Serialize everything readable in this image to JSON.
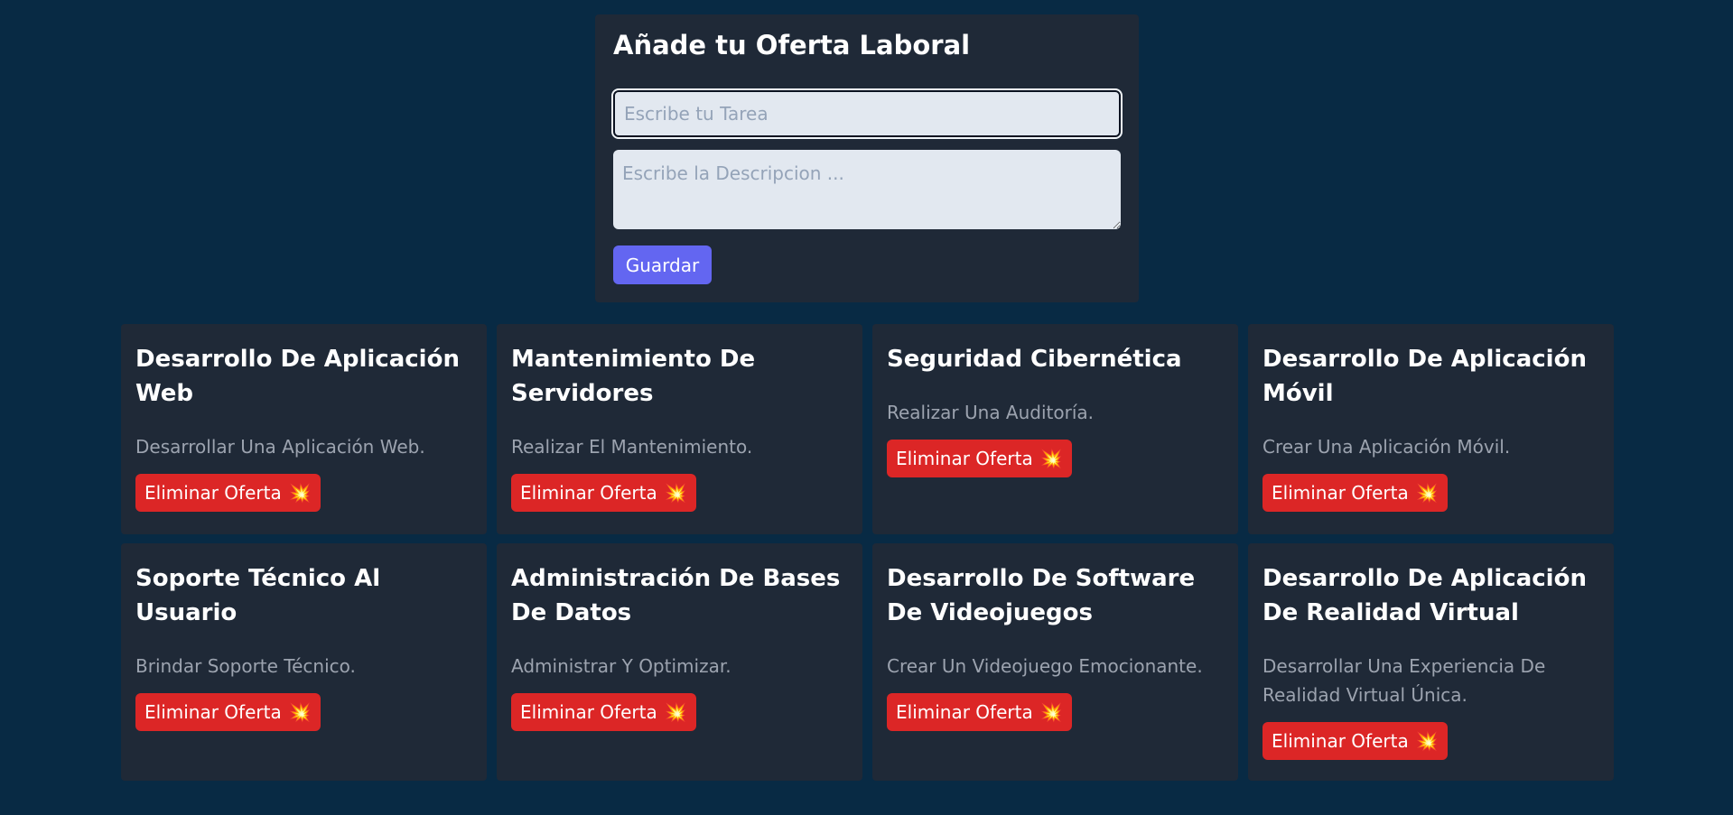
{
  "form": {
    "title": "Añade tu Oferta Laboral",
    "task_placeholder": "Escribe tu Tarea",
    "task_value": "",
    "description_placeholder": "Escribe la Descripcion ...",
    "description_value": "",
    "save_label": "Guardar"
  },
  "jobs": [
    {
      "title": "Desarrollo De Aplicación Web",
      "description": "Desarrollar Una Aplicación Web.",
      "delete_label": "Eliminar Oferta",
      "delete_icon": "💥"
    },
    {
      "title": "Mantenimiento De Servidores",
      "description": "Realizar El Mantenimiento.",
      "delete_label": "Eliminar Oferta",
      "delete_icon": "💥"
    },
    {
      "title": "Seguridad Cibernética",
      "description": "Realizar Una Auditoría.",
      "delete_label": "Eliminar Oferta",
      "delete_icon": "💥"
    },
    {
      "title": "Desarrollo De Aplicación Móvil",
      "description": "Crear Una Aplicación Móvil.",
      "delete_label": "Eliminar Oferta",
      "delete_icon": "💥"
    },
    {
      "title": "Soporte Técnico Al Usuario",
      "description": "Brindar Soporte Técnico.",
      "delete_label": "Eliminar Oferta",
      "delete_icon": "💥"
    },
    {
      "title": "Administración De Bases De Datos",
      "description": "Administrar Y Optimizar.",
      "delete_label": "Eliminar Oferta",
      "delete_icon": "💥"
    },
    {
      "title": "Desarrollo De Software De Videojuegos",
      "description": "Crear Un Videojuego Emocionante.",
      "delete_label": "Eliminar Oferta",
      "delete_icon": "💥"
    },
    {
      "title": "Desarrollo De Aplicación De Realidad Virtual",
      "description": "Desarrollar Una Experiencia De Realidad Virtual Única.",
      "delete_label": "Eliminar Oferta",
      "delete_icon": "💥"
    }
  ],
  "colors": {
    "page_background": "#082a44",
    "card_background": "#1f2937",
    "save_button": "#6366f1",
    "delete_button": "#dc2626"
  }
}
